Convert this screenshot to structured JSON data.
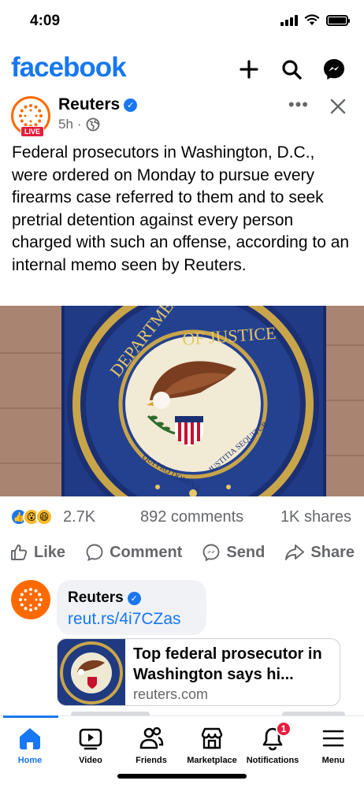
{
  "status_bar": {
    "time": "4:09"
  },
  "header": {
    "logo": "facebook",
    "icons": [
      "plus-icon",
      "search-icon",
      "messenger-icon"
    ]
  },
  "post": {
    "author": "Reuters",
    "live_badge": "LIVE",
    "time": "5h",
    "audience_icon": "globe-icon",
    "more": "•••",
    "text": "Federal prosecutors in Washington, D.C., were ordered on Monday to pursue every firearms case referred to them and to seek pretrial detention against every person charged with such an offense, according to an internal memo seen by Reuters.",
    "image": {
      "seal_top": "DEPARTMENT OF JUSTICE",
      "seal_motto": "QUI PRO DOMINA JUSTITIA SEQUITUR"
    },
    "reactions": {
      "count": "2.7K",
      "comments": "892 comments",
      "shares": "1K shares",
      "icons": [
        "like-reaction-icon",
        "wow-reaction-icon",
        "haha-reaction-icon"
      ]
    },
    "actions": {
      "like": "Like",
      "comment": "Comment",
      "send": "Send",
      "share": "Share"
    }
  },
  "comment": {
    "author": "Reuters",
    "link_text": "reut.rs/4i7CZas",
    "preview": {
      "title": "Top federal prosecutor in Washington says hi...",
      "domain": "reuters.com"
    }
  },
  "bottom_nav": {
    "items": [
      {
        "label": "Home",
        "icon": "home-icon",
        "active": true
      },
      {
        "label": "Video",
        "icon": "video-icon"
      },
      {
        "label": "Friends",
        "icon": "friends-icon"
      },
      {
        "label": "Marketplace",
        "icon": "marketplace-icon"
      },
      {
        "label": "Notifications",
        "icon": "bell-icon",
        "badge": "1"
      },
      {
        "label": "Menu",
        "icon": "menu-icon"
      }
    ]
  },
  "colors": {
    "brand": "#1877f2",
    "reuters_orange": "#ff6a00",
    "notification_red": "#e41e3f",
    "secondary_text": "#65676b"
  }
}
